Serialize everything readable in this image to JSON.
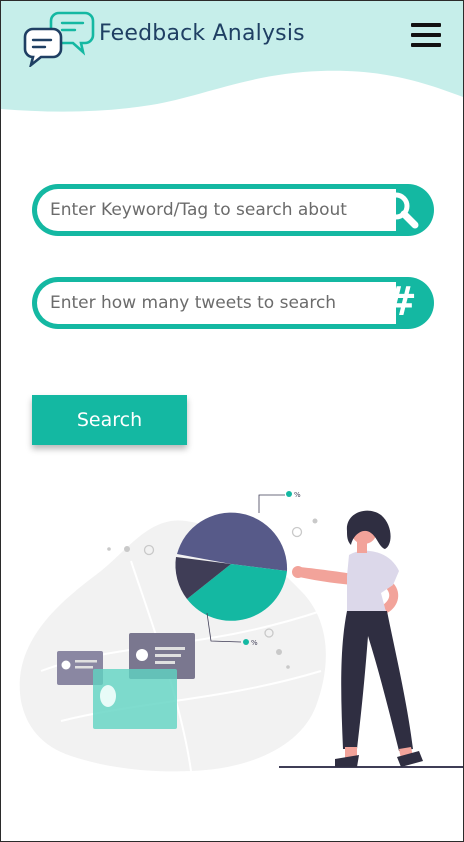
{
  "header": {
    "title": "Feedback Analysis",
    "logo_icon": "chat-bubbles-icon",
    "menu_icon": "hamburger-menu-icon"
  },
  "search": {
    "keyword_placeholder": "Enter Keyword/Tag to search about",
    "keyword_value": "",
    "keyword_icon": "search-icon",
    "count_placeholder": "Enter how many tweets to search",
    "count_value": "",
    "count_icon": "hash-icon",
    "hash_glyph": "#",
    "button_label": "Search"
  },
  "illustration": {
    "callout_labels": [
      "%",
      "%"
    ]
  },
  "colors": {
    "accent": "#14b8a2",
    "header_bg": "#c6eeea",
    "title_text": "#1f3f63",
    "pie_purple": "#575a89",
    "pie_dark": "#3f3d56"
  }
}
